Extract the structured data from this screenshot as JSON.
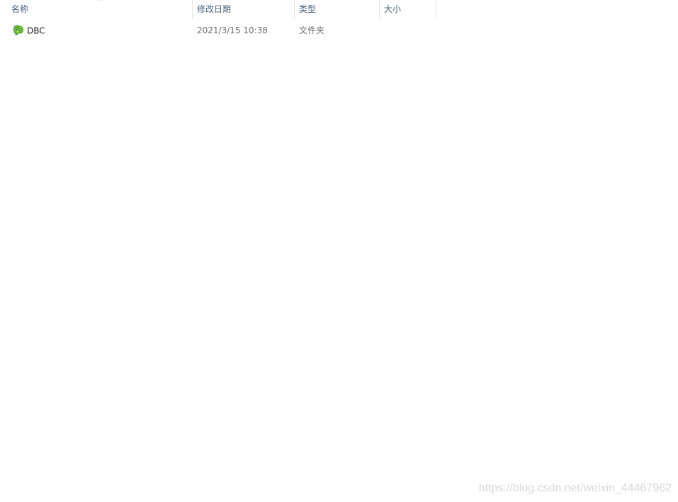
{
  "columns": {
    "name": "名称",
    "modified": "修改日期",
    "type": "类型",
    "size": "大小",
    "sort_indicator": "^"
  },
  "files": [
    {
      "name": "DBC",
      "modified": "2021/3/15 10:38",
      "type": "文件夹",
      "size": "",
      "icon": "green-folder-icon"
    }
  ],
  "watermark": "https://blog.csdn.net/weixin_44467962",
  "colors": {
    "header_text": "#4c607a",
    "icon_green": "#5aa832"
  }
}
